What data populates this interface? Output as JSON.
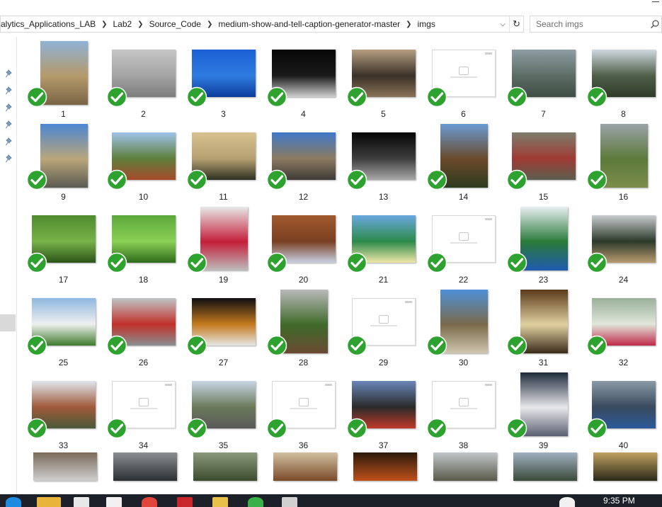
{
  "window": {
    "breadcrumbs": [
      "alytics_Applications_LAB",
      "Lab2",
      "Source_Code",
      "medium-show-and-tell-caption-generator-master",
      "imgs"
    ],
    "search_placeholder": "Search imgs"
  },
  "status_color": "#2ea22e",
  "files": [
    {
      "name": "1",
      "colors": [
        "#8fb2d6",
        "#b59a6a",
        "#7a6446"
      ],
      "thumb_type": "portrait"
    },
    {
      "name": "2",
      "colors": [
        "#c5c5c5",
        "#a4a4a4",
        "#7d7d7d"
      ],
      "thumb_type": "landscape"
    },
    {
      "name": "3",
      "colors": [
        "#1b5fd4",
        "#2f7be0",
        "#0d3c9c"
      ],
      "thumb_type": "landscape"
    },
    {
      "name": "4",
      "colors": [
        "#070707",
        "#1a1a1a",
        "#cfcfcf"
      ],
      "thumb_type": "landscape"
    },
    {
      "name": "5",
      "colors": [
        "#b69f82",
        "#3a3127",
        "#8a7258"
      ],
      "thumb_type": "landscape"
    },
    {
      "name": "6",
      "colors": [],
      "thumb_type": "placeholder"
    },
    {
      "name": "7",
      "colors": [
        "#8e9ea3",
        "#5d6d66",
        "#3f4f44"
      ],
      "thumb_type": "landscape"
    },
    {
      "name": "8",
      "colors": [
        "#cfd8e0",
        "#4f5f48",
        "#2f3a2a"
      ],
      "thumb_type": "landscape"
    },
    {
      "name": "9",
      "colors": [
        "#4d86d2",
        "#b9a77a",
        "#5a5a52"
      ],
      "thumb_type": "portrait"
    },
    {
      "name": "10",
      "colors": [
        "#9fc3ea",
        "#5e7f3c",
        "#a64a2a"
      ],
      "thumb_type": "landscape"
    },
    {
      "name": "11",
      "colors": [
        "#d7c28f",
        "#b7a070",
        "#2e3124"
      ],
      "thumb_type": "landscape"
    },
    {
      "name": "12",
      "colors": [
        "#3f78c8",
        "#8c7b62",
        "#3e3a36"
      ],
      "thumb_type": "landscape"
    },
    {
      "name": "13",
      "colors": [
        "#050505",
        "#3d3d3d",
        "#a8a8a8"
      ],
      "thumb_type": "landscape"
    },
    {
      "name": "14",
      "colors": [
        "#6b9ad3",
        "#6a4a2a",
        "#2d3a1e"
      ],
      "thumb_type": "portrait"
    },
    {
      "name": "15",
      "colors": [
        "#7c7e6c",
        "#a03a34",
        "#5b5f4f"
      ],
      "thumb_type": "landscape"
    },
    {
      "name": "16",
      "colors": [
        "#9aa2a8",
        "#5c7a3a",
        "#7c8d4a"
      ],
      "thumb_type": "portrait"
    },
    {
      "name": "17",
      "colors": [
        "#4f8a2c",
        "#78b24a",
        "#2b5419"
      ],
      "thumb_type": "landscape"
    },
    {
      "name": "18",
      "colors": [
        "#5aa83a",
        "#8bd056",
        "#2f6a1b"
      ],
      "thumb_type": "landscape"
    },
    {
      "name": "19",
      "colors": [
        "#e8e8e8",
        "#c41e3a",
        "#bdbdbd"
      ],
      "thumb_type": "portrait"
    },
    {
      "name": "20",
      "colors": [
        "#a05a2e",
        "#7a3f22",
        "#c7d0e2"
      ],
      "thumb_type": "landscape"
    },
    {
      "name": "21",
      "colors": [
        "#6aa8e0",
        "#2c8a4a",
        "#efe7a8"
      ],
      "thumb_type": "landscape"
    },
    {
      "name": "22",
      "colors": [],
      "thumb_type": "placeholder"
    },
    {
      "name": "23",
      "colors": [
        "#e8eef2",
        "#2a7a3a",
        "#1f5ab0"
      ],
      "thumb_type": "portrait"
    },
    {
      "name": "24",
      "colors": [
        "#c8ccd0",
        "#2c3a2a",
        "#b79a6e"
      ],
      "thumb_type": "landscape"
    },
    {
      "name": "25",
      "colors": [
        "#8fb8e0",
        "#efefef",
        "#3e7a2c"
      ],
      "thumb_type": "landscape"
    },
    {
      "name": "26",
      "colors": [
        "#bfc4c6",
        "#c0302a",
        "#8a8f92"
      ],
      "thumb_type": "landscape"
    },
    {
      "name": "27",
      "colors": [
        "#0e0e12",
        "#c47a1e",
        "#e6e6e6"
      ],
      "thumb_type": "landscape"
    },
    {
      "name": "28",
      "colors": [
        "#b9b9b9",
        "#3f6a2a",
        "#6a4a32"
      ],
      "thumb_type": "portrait"
    },
    {
      "name": "29",
      "colors": [],
      "thumb_type": "placeholder"
    },
    {
      "name": "30",
      "colors": [
        "#4f8fd8",
        "#7a6a4a",
        "#d0c7b0"
      ],
      "thumb_type": "portrait"
    },
    {
      "name": "31",
      "colors": [
        "#5a3a1a",
        "#e0d0a0",
        "#3a2a1a"
      ],
      "thumb_type": "portrait"
    },
    {
      "name": "32",
      "colors": [
        "#9ab09a",
        "#e0e6da",
        "#c02a4a"
      ],
      "thumb_type": "landscape"
    },
    {
      "name": "33",
      "colors": [
        "#e0e6ee",
        "#a05a3a",
        "#4a5a3a"
      ],
      "thumb_type": "landscape"
    },
    {
      "name": "34",
      "colors": [],
      "thumb_type": "placeholder"
    },
    {
      "name": "35",
      "colors": [
        "#c8d6e6",
        "#6a7a5a",
        "#5a5a5a"
      ],
      "thumb_type": "landscape"
    },
    {
      "name": "36",
      "colors": [],
      "thumb_type": "placeholder"
    },
    {
      "name": "37",
      "colors": [
        "#6a86b8",
        "#2a2a2a",
        "#c03a2a"
      ],
      "thumb_type": "landscape"
    },
    {
      "name": "38",
      "colors": [],
      "thumb_type": "placeholder"
    },
    {
      "name": "39",
      "colors": [
        "#1e2a3a",
        "#e8e8ec",
        "#5a6070"
      ],
      "thumb_type": "portrait"
    },
    {
      "name": "40",
      "colors": [
        "#8a9aa6",
        "#3a4a5e",
        "#2a5a9a"
      ],
      "thumb_type": "landscape"
    }
  ],
  "partial_row_colors": [
    [
      "#7a6a5a",
      "#cfcfcf"
    ],
    [
      "#8a8f92",
      "#2a2f32"
    ],
    [
      "#8a9a7a",
      "#3a4a2a"
    ],
    [
      "#d0c0a0",
      "#7a4a2a"
    ],
    [
      "#2a1a0a",
      "#c0501a"
    ],
    [
      "#c0c6ca",
      "#5a5a4a"
    ],
    [
      "#a0b0c0",
      "#3a4a3a"
    ],
    [
      "#c0a060",
      "#2a2a1a"
    ]
  ],
  "taskbar": {
    "time": "9:35 PM",
    "icons": [
      "cortana-icon",
      "file-explorer-icon",
      "store-icon",
      "graduation-cap-icon",
      "chrome-icon",
      "pdf-icon",
      "paint-icon",
      "sync-icon",
      "snipping-icon",
      "network-icon"
    ]
  }
}
